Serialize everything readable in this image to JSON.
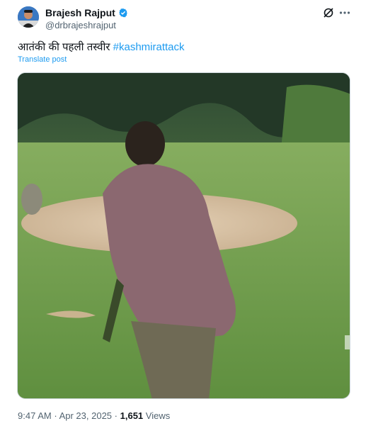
{
  "author": {
    "display_name": "Brajesh Rajput",
    "handle": "@drbrajeshrajput",
    "verified": true
  },
  "post": {
    "text": "आतंकी की पहली तस्वीर",
    "hashtag": "#kashmirattack",
    "translate_label": "Translate post"
  },
  "media": {
    "type": "video-still"
  },
  "footer": {
    "time": "9:47 AM",
    "separator": "·",
    "date": "Apr 23, 2025",
    "views_count": "1,651",
    "views_label": "Views"
  },
  "colors": {
    "accent": "#1d9bf0",
    "text": "#0f1419",
    "secondary": "#536471"
  },
  "icons": [
    "verified-badge-icon",
    "grok-icon",
    "more-icon"
  ]
}
